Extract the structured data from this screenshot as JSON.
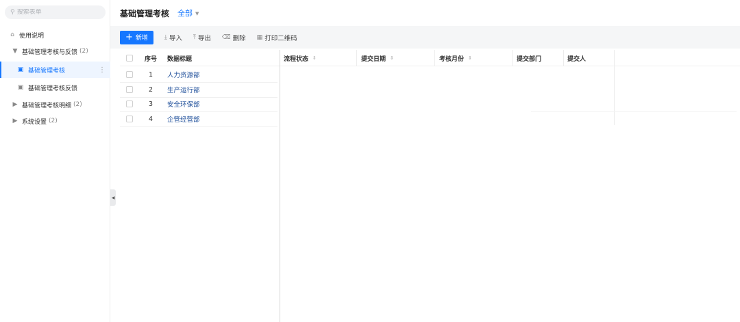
{
  "sidebar": {
    "search_placeholder": "搜索表单",
    "items": [
      {
        "label": "使用说明",
        "icon": "home-icon"
      },
      {
        "label": "基础管理考核与反馈",
        "count": "(2)",
        "icon": "caret-down-icon"
      },
      {
        "label": "基础管理考核",
        "icon": "form-icon",
        "active": true
      },
      {
        "label": "基础管理考核反馈",
        "icon": "form-icon"
      },
      {
        "label": "基础管理考核明细",
        "count": "(2)",
        "icon": "caret-right-icon"
      },
      {
        "label": "系统设置",
        "count": "(2)",
        "icon": "caret-right-icon"
      }
    ]
  },
  "header": {
    "title": "基础管理考核",
    "filter": "全部"
  },
  "toolbar": {
    "add": "新增",
    "import": "导入",
    "export": "导出",
    "delete": "删除",
    "print_qr": "打印二维码"
  },
  "table": {
    "columns": [
      "序号",
      "数据标题",
      "流程状态",
      "提交日期",
      "考核月份",
      "提交部门",
      "提交人"
    ],
    "rows": [
      {
        "index": "1",
        "title": "人力资源部"
      },
      {
        "index": "2",
        "title": "生产运行部"
      },
      {
        "index": "3",
        "title": "安全环保部"
      },
      {
        "index": "4",
        "title": "企管经营部"
      }
    ]
  },
  "colors": {
    "accent": "#1677ff",
    "active_bg": "#eef5ff"
  }
}
